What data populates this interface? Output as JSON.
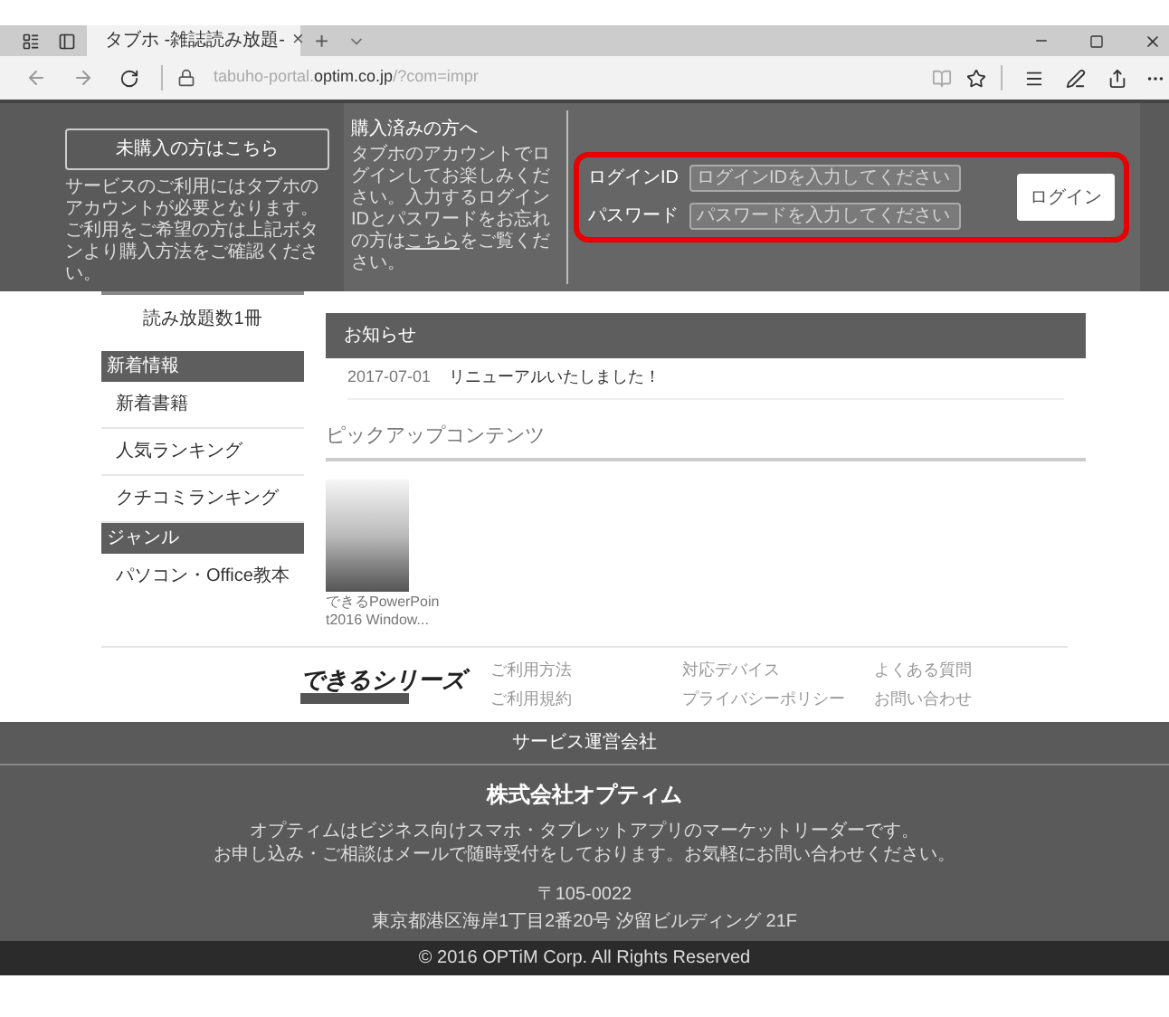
{
  "browser": {
    "tab_title": "タブホ -雑誌読み放題-",
    "tab_close": "×",
    "new_tab": "+",
    "url": "tabuho-portal.**optim.co.jp**/?com=impr"
  },
  "header": {
    "signup_button": "未購入の方はこちら",
    "signup_note": "サービスのご利用にはタブホのアカウントが必要となります。ご利用をご希望の方は上記ボタンより購入方法をご確認ください。",
    "login_title": "購入済みの方へ",
    "login_note_before": "タブホのアカウントでログインしてお楽しみください。入力するログインIDとパスワードをお忘れの方は",
    "login_note_link": "こちら",
    "login_note_after": "をご覧ください。",
    "id_label": "ログインID",
    "id_placeholder": "ログインIDを入力してください",
    "password_label": "パスワード",
    "password_placeholder": "パスワードを入力してください",
    "login_button": "ログイン",
    "highlighted": true
  },
  "sidebar": [
    {
      "kind": "count",
      "label": "読み放題数1冊"
    },
    {
      "kind": "section",
      "label": "新着情報"
    },
    {
      "kind": "link",
      "label": "新着書籍"
    },
    {
      "kind": "link",
      "label": "人気ランキング"
    },
    {
      "kind": "link",
      "label": "クチコミランキング"
    },
    {
      "kind": "section",
      "label": "ジャンル"
    },
    {
      "kind": "link",
      "label": "パソコン・Office教本"
    }
  ],
  "news": {
    "title": "お知らせ",
    "items": [
      {
        "date": "2017-07-01",
        "text": "リニューアルいたしました！"
      }
    ]
  },
  "pickup": {
    "title": "ピックアップコンテンツ",
    "items": [
      {
        "caption": "できるPowerPoin t2016 Window..."
      }
    ]
  },
  "footer_links": {
    "logo": "できるシリーズ",
    "columns": [
      [
        "ご利用方法",
        "ご利用規約"
      ],
      [
        "対応デバイス",
        "プライバシーポリシー"
      ],
      [
        "よくある質問",
        "お問い合わせ"
      ]
    ]
  },
  "company": {
    "heading": "サービス運営会社",
    "name": "株式会社オプティム",
    "lines": [
      "オプティムはビジネス向けスマホ・タブレットアプリのマーケットリーダーです。",
      "お申し込み・ご相談はメールで随時受付をしております。お気軽にお問い合わせください。"
    ],
    "postcode": "〒105-0022",
    "address": "東京都港区海岸1丁目2番20号 汐留ビルディング 21F"
  },
  "copyright": "© 2016 OPTiM Corp. All Rights Reserved"
}
